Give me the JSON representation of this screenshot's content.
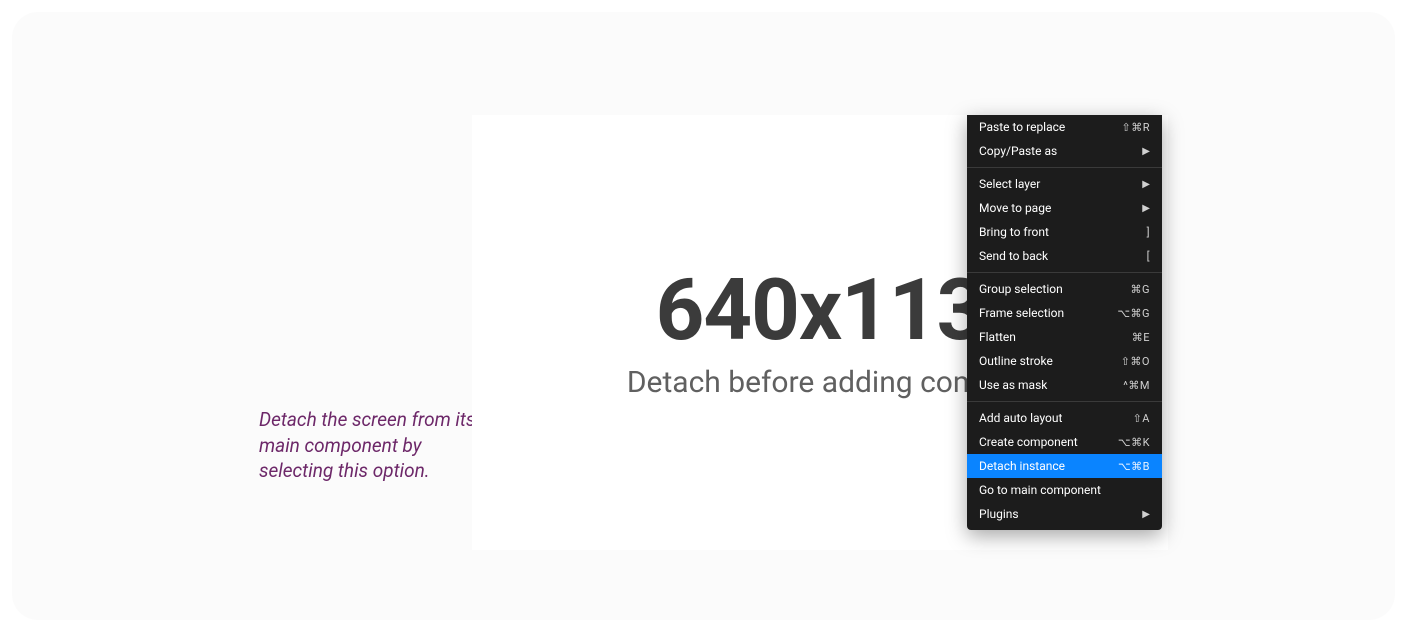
{
  "annotation": "Detach the screen from its main component by selecting this option.",
  "artboard": {
    "dimensions": "640x113",
    "subtitle": "Detach before adding compo"
  },
  "menu": {
    "groups": [
      [
        {
          "label": "Paste to replace",
          "shortcut": "⇧⌘R",
          "submenu": false
        },
        {
          "label": "Copy/Paste as",
          "shortcut": "",
          "submenu": true
        }
      ],
      [
        {
          "label": "Select layer",
          "shortcut": "",
          "submenu": true
        },
        {
          "label": "Move to page",
          "shortcut": "",
          "submenu": true
        },
        {
          "label": "Bring to front",
          "shortcut": "]",
          "submenu": false
        },
        {
          "label": "Send to back",
          "shortcut": "[",
          "submenu": false
        }
      ],
      [
        {
          "label": "Group selection",
          "shortcut": "⌘G",
          "submenu": false
        },
        {
          "label": "Frame selection",
          "shortcut": "⌥⌘G",
          "submenu": false
        },
        {
          "label": "Flatten",
          "shortcut": "⌘E",
          "submenu": false
        },
        {
          "label": "Outline stroke",
          "shortcut": "⇧⌘O",
          "submenu": false
        },
        {
          "label": "Use as mask",
          "shortcut": "^⌘M",
          "submenu": false
        }
      ],
      [
        {
          "label": "Add auto layout",
          "shortcut": "⇧A",
          "submenu": false
        },
        {
          "label": "Create component",
          "shortcut": "⌥⌘K",
          "submenu": false
        },
        {
          "label": "Detach instance",
          "shortcut": "⌥⌘B",
          "submenu": false,
          "highlight": true
        },
        {
          "label": "Go to main component",
          "shortcut": "",
          "submenu": false
        },
        {
          "label": "Plugins",
          "shortcut": "",
          "submenu": true
        }
      ]
    ]
  }
}
